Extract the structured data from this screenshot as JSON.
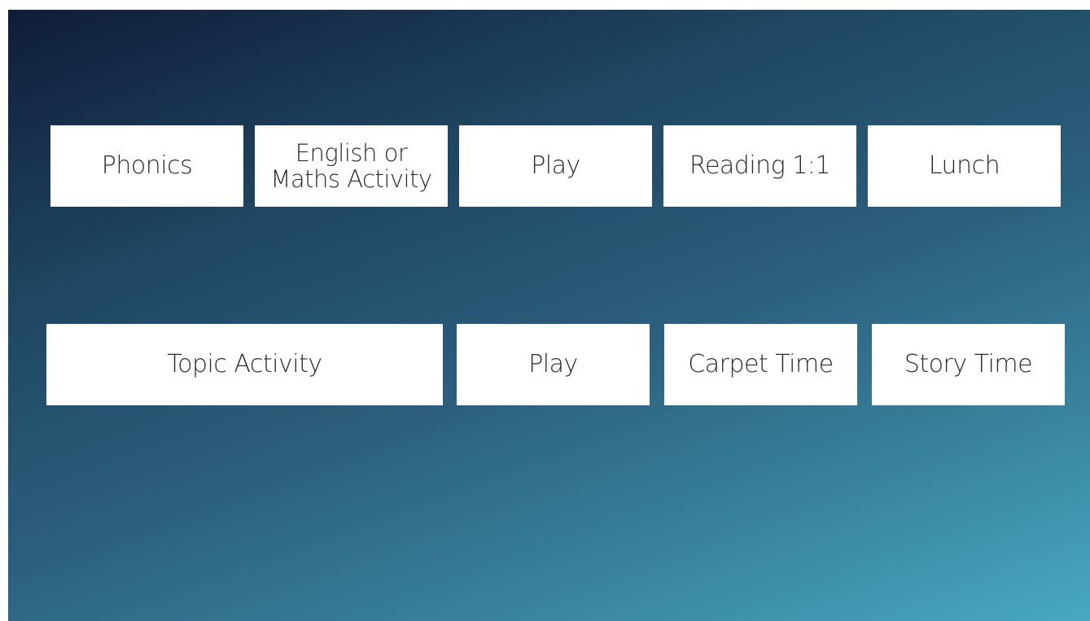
{
  "schedule": {
    "row1": [
      {
        "label": "Phonics"
      },
      {
        "label": "English or Maths Activity"
      },
      {
        "label": "Play"
      },
      {
        "label": "Reading 1:1"
      },
      {
        "label": "Lunch"
      }
    ],
    "row2": [
      {
        "label": "Topic Activity"
      },
      {
        "label": "Play"
      },
      {
        "label": "Carpet Time"
      },
      {
        "label": "Story Time"
      }
    ]
  },
  "colors": {
    "card_background": "#ffffff",
    "card_text": "#2b2b2b",
    "gradient_start": "#101c38",
    "gradient_end": "#48a8c2"
  }
}
